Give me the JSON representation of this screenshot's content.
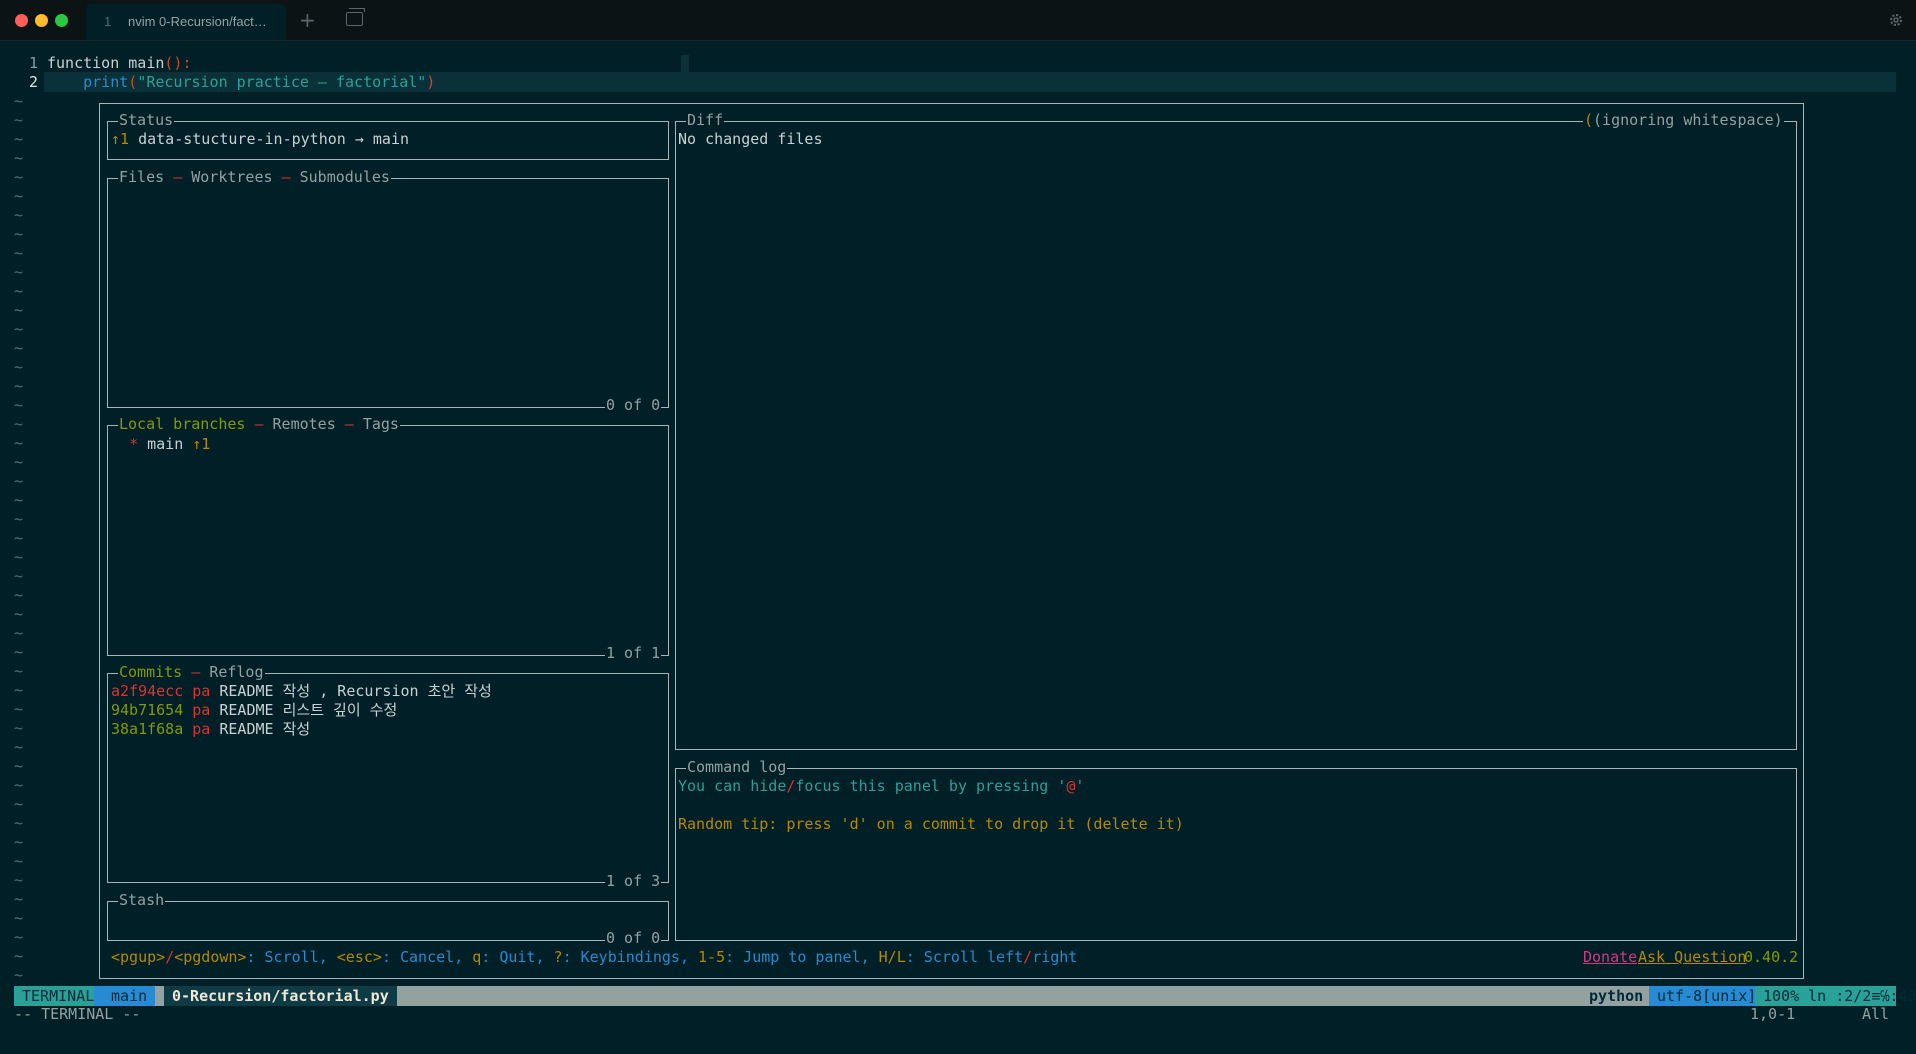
{
  "window": {
    "tab_number": "1",
    "tab_title": "nvim 0-Recursion/fact…",
    "new_tab_symbol": "+",
    "icons": [
      "close-light",
      "minimize-light",
      "zoom-light",
      "new-tab-icon",
      "tab-overview-icon",
      "gear-icon"
    ]
  },
  "editor": {
    "lines": [
      {
        "num": "1",
        "text": "function main():"
      },
      {
        "num": "2",
        "text": "    print(\"Recursion practice – factorial\")"
      }
    ],
    "tilde": "~"
  },
  "lazygit": {
    "status": {
      "title": "Status",
      "ahead": "↑1",
      "repo": "data-stucture-in-python",
      "arrow": "→",
      "branch": "main"
    },
    "files": {
      "tabs": [
        "Files",
        "Worktrees",
        "Submodules"
      ],
      "sep": "–",
      "count": "0 of 0"
    },
    "branches": {
      "tabs": [
        "Local branches",
        "Remotes",
        "Tags"
      ],
      "items": [
        {
          "star": "*",
          "name": "main",
          "ahead": "↑1"
        }
      ],
      "count": "1 of 1"
    },
    "commits": {
      "tabs": [
        "Commits",
        "Reflog"
      ],
      "items": [
        {
          "hash": "a2f94ecc",
          "author": "pa",
          "msg": "README 작성 , Recursion 초안 작성"
        },
        {
          "hash": "94b71654",
          "author": "pa",
          "msg": "README 리스트 깊이 수정"
        },
        {
          "hash": "38a1f68a",
          "author": "pa",
          "msg": "README 작성"
        }
      ],
      "count": "1 of 3"
    },
    "stash": {
      "title": "Stash",
      "count": "0 of 0"
    },
    "diff": {
      "title": "Diff",
      "note": "(ignoring whitespace)",
      "content": "No changed files"
    },
    "command_log": {
      "title": "Command log",
      "line1_a": "You can hide",
      "line1_slash": "/",
      "line1_b": "focus this panel by pressing '",
      "line1_at": "@",
      "line1_end": "'",
      "tip_label": "Random tip:",
      "tip_text": "press 'd' on a commit to drop it (delete it)"
    },
    "footer": {
      "k1": "<pgup>",
      "s1": "/",
      "k2": "<pgdown>",
      "d1": ": Scroll, ",
      "k3": "<esc>",
      "d2": ": Cancel, ",
      "k4": "q",
      "d3": ": Quit, ",
      "k5": "?",
      "d4": ": Keybindings, ",
      "k6": "1-5",
      "d5": ": Jump to panel, ",
      "k7": "H/L",
      "d6": ": Scroll left",
      "s2": "/",
      "d7": "right",
      "donate": "Donate",
      "ask": "Ask Question",
      "version": "0.40.2"
    }
  },
  "statusline": {
    "mode": "TERMINAL",
    "branch_icon": "",
    "branch": "main",
    "file": "0-Recursion/factorial.py",
    "filetype": "python",
    "encoding": "utf-8[unix]",
    "percent": "100%",
    "position": "ln :2/2≡℅:43"
  },
  "cmdline": {
    "mode": "-- TERMINAL --",
    "ruler": "1,0-1",
    "scroll": "All"
  },
  "colors": {
    "background": "#011f26",
    "statusline_mode": "#2aa198",
    "statusline_branch": "#268bd2"
  }
}
